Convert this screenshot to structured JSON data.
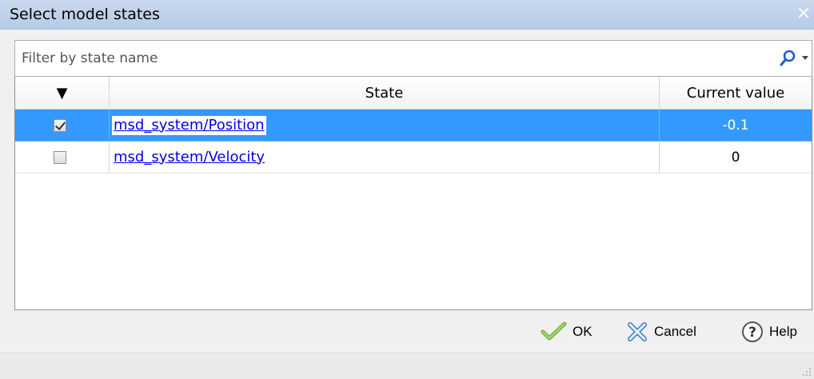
{
  "window": {
    "title": "Select model states",
    "close_glyph": "×"
  },
  "filter": {
    "placeholder": "Filter by state name",
    "icon": "search-icon"
  },
  "table": {
    "headers": {
      "check": "▼",
      "state": "State",
      "value": "Current value"
    },
    "rows": [
      {
        "checked": true,
        "state": "msd_system/Position",
        "value": "-0.1",
        "selected": true
      },
      {
        "checked": false,
        "state": "msd_system/Velocity",
        "value": "0",
        "selected": false
      }
    ]
  },
  "buttons": {
    "ok": "OK",
    "cancel": "Cancel",
    "help": "Help"
  },
  "colors": {
    "selection": "#3399ff",
    "link": "#0000ee",
    "titlebar": "#c9d9ee"
  }
}
